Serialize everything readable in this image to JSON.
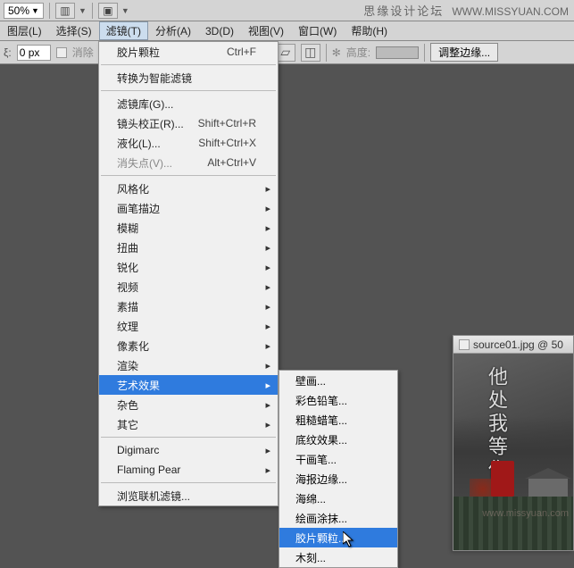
{
  "toolbar": {
    "zoom": "50%"
  },
  "watermark": {
    "cn": "思缘设计论坛",
    "en": "WWW.MISSYUAN.COM",
    "url": "www.missyuan.com"
  },
  "menubar": [
    "图层(L)",
    "选择(S)",
    "滤镜(T)",
    "分析(A)",
    "3D(D)",
    "视图(V)",
    "窗口(W)",
    "帮助(H)"
  ],
  "optbar": {
    "px_label": "ξ:",
    "px_value": "0 px",
    "erase_label": "消除",
    "height_label": "高度:",
    "refine_label": "调整边缘..."
  },
  "filter_menu": {
    "recent": {
      "label": "胶片颗粒",
      "shortcut": "Ctrl+F"
    },
    "smart": "转换为智能滤镜",
    "gallery": "滤镜库(G)...",
    "lens": {
      "label": "镜头校正(R)...",
      "shortcut": "Shift+Ctrl+R"
    },
    "liquify": {
      "label": "液化(L)...",
      "shortcut": "Shift+Ctrl+X"
    },
    "vanish": {
      "label": "消失点(V)...",
      "shortcut": "Alt+Ctrl+V"
    },
    "groups": [
      "风格化",
      "画笔描边",
      "模糊",
      "扭曲",
      "锐化",
      "视频",
      "素描",
      "纹理",
      "像素化",
      "渲染",
      "艺术效果",
      "杂色",
      "其它"
    ],
    "digimarc": "Digimarc",
    "flaming": "Flaming Pear",
    "browse": "浏览联机滤镜..."
  },
  "artistic_submenu": [
    "壁画...",
    "彩色铅笔...",
    "粗糙蜡笔...",
    "底纹效果...",
    "干画笔...",
    "海报边缘...",
    "海绵...",
    "绘画涂抹...",
    "胶片颗粒...",
    "木刻..."
  ],
  "doc": {
    "title": "source01.jpg @ 50",
    "calli": "他处我等你"
  }
}
